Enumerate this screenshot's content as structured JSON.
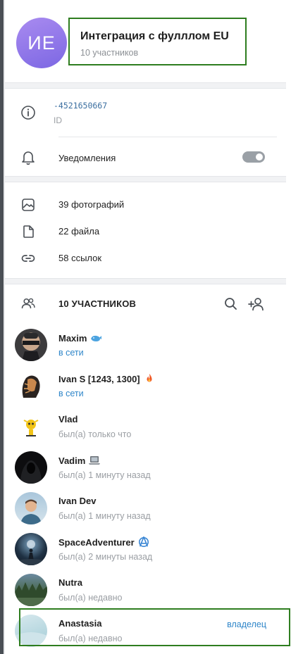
{
  "group": {
    "initials": "ИЕ",
    "title": "Интеграция с фулллом EU",
    "members_count": "10 участников",
    "avatar_color": "#8b76e8"
  },
  "info": {
    "id_value": "-4521650667",
    "id_label": "ID",
    "notifications_label": "Уведомления",
    "notifications_enabled": false
  },
  "media": {
    "photos": "39 фотографий",
    "files": "22 файла",
    "links": "58 ссылок"
  },
  "members_section": {
    "title": "10 УЧАСТНИКОВ",
    "search_icon": "search-icon",
    "add_icon": "add-member-icon"
  },
  "members": [
    {
      "name": "Maxim",
      "status": "в сети",
      "online": true,
      "badge": "whale-icon",
      "role": ""
    },
    {
      "name": "Ivan S [1243, 1300]",
      "status": "в сети",
      "online": true,
      "badge": "fire-icon",
      "role": ""
    },
    {
      "name": "Vlad",
      "status": "был(а) только что",
      "online": false,
      "badge": "",
      "role": ""
    },
    {
      "name": "Vadim",
      "status": "был(а) 1 минуту назад",
      "online": false,
      "badge": "laptop-icon",
      "role": ""
    },
    {
      "name": "Ivan Dev",
      "status": "был(а) 1 минуту назад",
      "online": false,
      "badge": "",
      "role": ""
    },
    {
      "name": "SpaceAdventurer",
      "status": "был(а) 2 минуты назад",
      "online": false,
      "badge": "anarchy-icon",
      "role": ""
    },
    {
      "name": "Nutra",
      "status": "был(а) недавно",
      "online": false,
      "badge": "",
      "role": ""
    },
    {
      "name": "Anastasia",
      "status": "был(а) недавно",
      "online": false,
      "badge": "",
      "role": "владелец"
    }
  ],
  "colors": {
    "accent": "#2f86c9",
    "highlight": "#2e7d1f",
    "muted": "#9a9ea3"
  }
}
